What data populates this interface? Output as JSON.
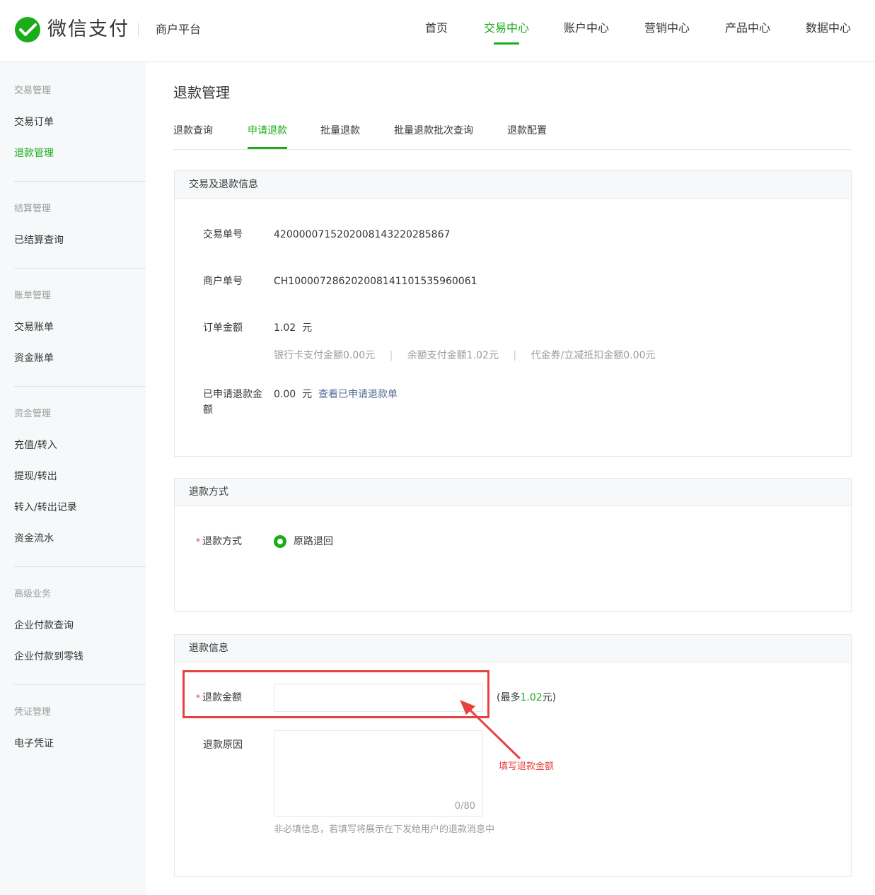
{
  "header": {
    "brand": "微信支付",
    "subtitle": "商户平台",
    "nav": [
      "首页",
      "交易中心",
      "账户中心",
      "营销中心",
      "产品中心",
      "数据中心"
    ],
    "active_nav": "交易中心"
  },
  "sidebar": {
    "groups": [
      {
        "title": "交易管理",
        "items": [
          "交易订单",
          "退款管理"
        ]
      },
      {
        "title": "结算管理",
        "items": [
          "已结算查询"
        ]
      },
      {
        "title": "账单管理",
        "items": [
          "交易账单",
          "资金账单"
        ]
      },
      {
        "title": "资金管理",
        "items": [
          "充值/转入",
          "提现/转出",
          "转入/转出记录",
          "资金流水"
        ]
      },
      {
        "title": "高级业务",
        "items": [
          "企业付款查询",
          "企业付款到零钱"
        ]
      },
      {
        "title": "凭证管理",
        "items": [
          "电子凭证"
        ]
      }
    ],
    "active_item": "退款管理"
  },
  "page": {
    "title": "退款管理",
    "tabs": [
      "退款查询",
      "申请退款",
      "批量退款",
      "批量退款批次查询",
      "退款配置"
    ],
    "active_tab": "申请退款"
  },
  "trade_panel": {
    "title": "交易及退款信息",
    "trade_no_label": "交易单号",
    "trade_no": "4200000715202008143220285867",
    "merchant_no_label": "商户单号",
    "merchant_no": "CH10000728620200814110153596006​1",
    "order_amount_label": "订单金额",
    "order_amount": "1.02",
    "unit": "元",
    "bank_card_amount": "银行卡支付金额0.00元",
    "balance_amount": "余额支付金额1.02元",
    "voucher_amount": "代金券/立减抵扣金额0.00元",
    "separator": "|",
    "refunded_label_1": "已申请退款金",
    "refunded_label_2": "额",
    "refunded_amount": "0.00",
    "view_refund_link": "查看已申请退款单"
  },
  "method_panel": {
    "title": "退款方式",
    "required_mark": "*",
    "label": "退款方式",
    "option": "原路退回"
  },
  "refund_panel": {
    "title": "退款信息",
    "required_mark": "*",
    "amount_label": "退款金额",
    "amount_value": "",
    "max_prefix": "(最多",
    "max_value": "1.02",
    "max_suffix": "元)",
    "reason_label": "退款原因",
    "reason_counter": "0/80",
    "reason_hint": "非必填信息，若填写将展示在下发给用户的退款消息中"
  },
  "annotation": {
    "text": "填写退款金额",
    "color": "#e64340"
  },
  "colors": {
    "accent": "#1aad19",
    "link": "#576b95",
    "required": "#e64340"
  }
}
